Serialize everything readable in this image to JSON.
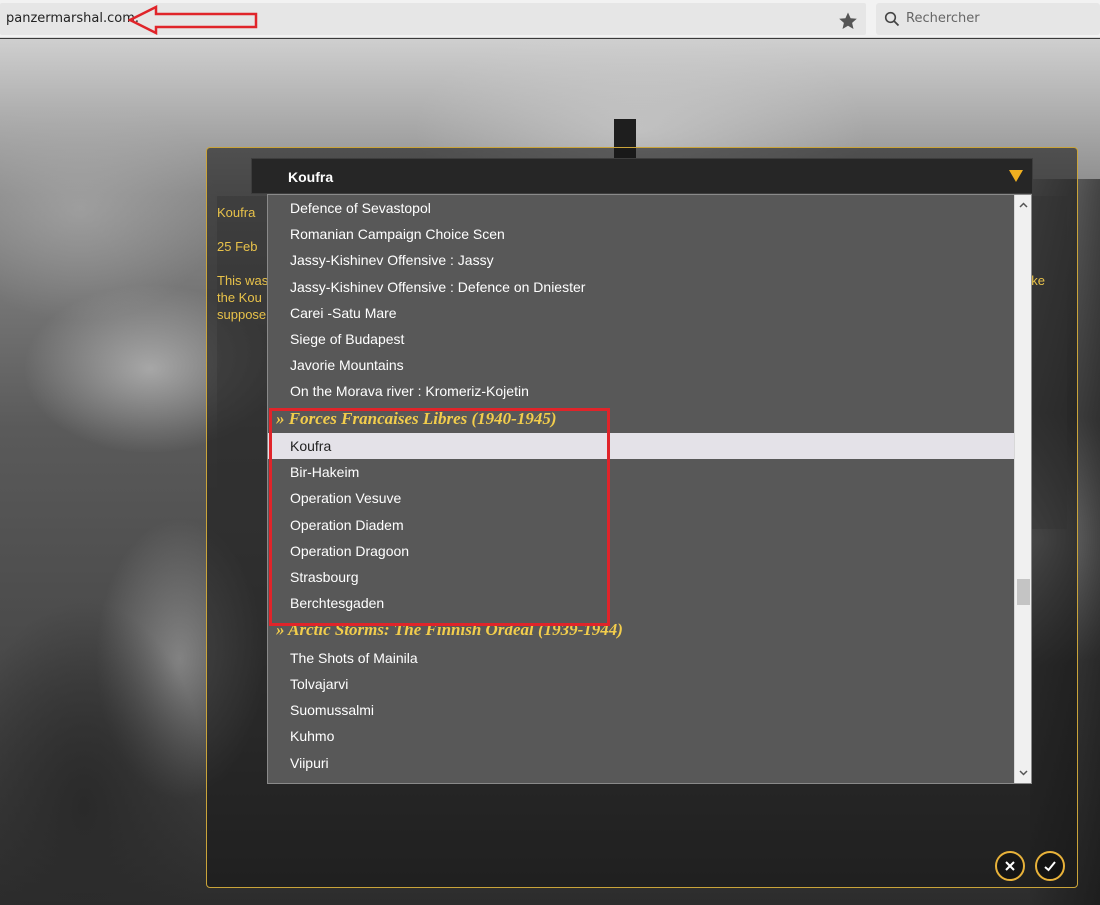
{
  "browser": {
    "url": "panzermarshal.com.",
    "search_placeholder": "Rechercher"
  },
  "dialog": {
    "selected_title": "Koufra",
    "desc_lines": [
      "Koufra",
      "25 Feb",
      "This was",
      "the Kou",
      "suppose",
      "ake"
    ]
  },
  "dropdown": {
    "items": [
      {
        "type": "item",
        "label": "Defence of Sevastopol"
      },
      {
        "type": "item",
        "label": "Romanian Campaign Choice Scen"
      },
      {
        "type": "item",
        "label": "Jassy-Kishinev Offensive : Jassy"
      },
      {
        "type": "item",
        "label": "Jassy-Kishinev Offensive : Defence on Dniester"
      },
      {
        "type": "item",
        "label": "Carei -Satu Mare"
      },
      {
        "type": "item",
        "label": "Siege of Budapest"
      },
      {
        "type": "item",
        "label": "Javorie Mountains"
      },
      {
        "type": "item",
        "label": "On the Morava river : Kromeriz-Kojetin"
      },
      {
        "type": "group",
        "label": "» Forces Francaises Libres (1940-1945)"
      },
      {
        "type": "item",
        "label": "Koufra",
        "selected": true
      },
      {
        "type": "item",
        "label": "Bir-Hakeim"
      },
      {
        "type": "item",
        "label": "Operation Vesuve"
      },
      {
        "type": "item",
        "label": "Operation Diadem"
      },
      {
        "type": "item",
        "label": "Operation Dragoon"
      },
      {
        "type": "item",
        "label": "Strasbourg"
      },
      {
        "type": "item",
        "label": "Berchtesgaden"
      },
      {
        "type": "group",
        "label": "» Arctic Storms: The Finnish Ordeal (1939-1944)"
      },
      {
        "type": "item",
        "label": "The Shots of Mainila"
      },
      {
        "type": "item",
        "label": "Tolvajarvi"
      },
      {
        "type": "item",
        "label": "Suomussalmi"
      },
      {
        "type": "item",
        "label": "Kuhmo"
      },
      {
        "type": "item",
        "label": "Viipuri"
      }
    ]
  },
  "colors": {
    "accent_gold": "#e8c24a",
    "annotation_red": "#e0242a",
    "selected_bg": "#e4e2e8"
  },
  "icons": [
    "star-icon",
    "search-icon",
    "dropdown-toggle-icon",
    "close-icon",
    "check-icon",
    "chevron-up-icon",
    "chevron-down-icon"
  ]
}
